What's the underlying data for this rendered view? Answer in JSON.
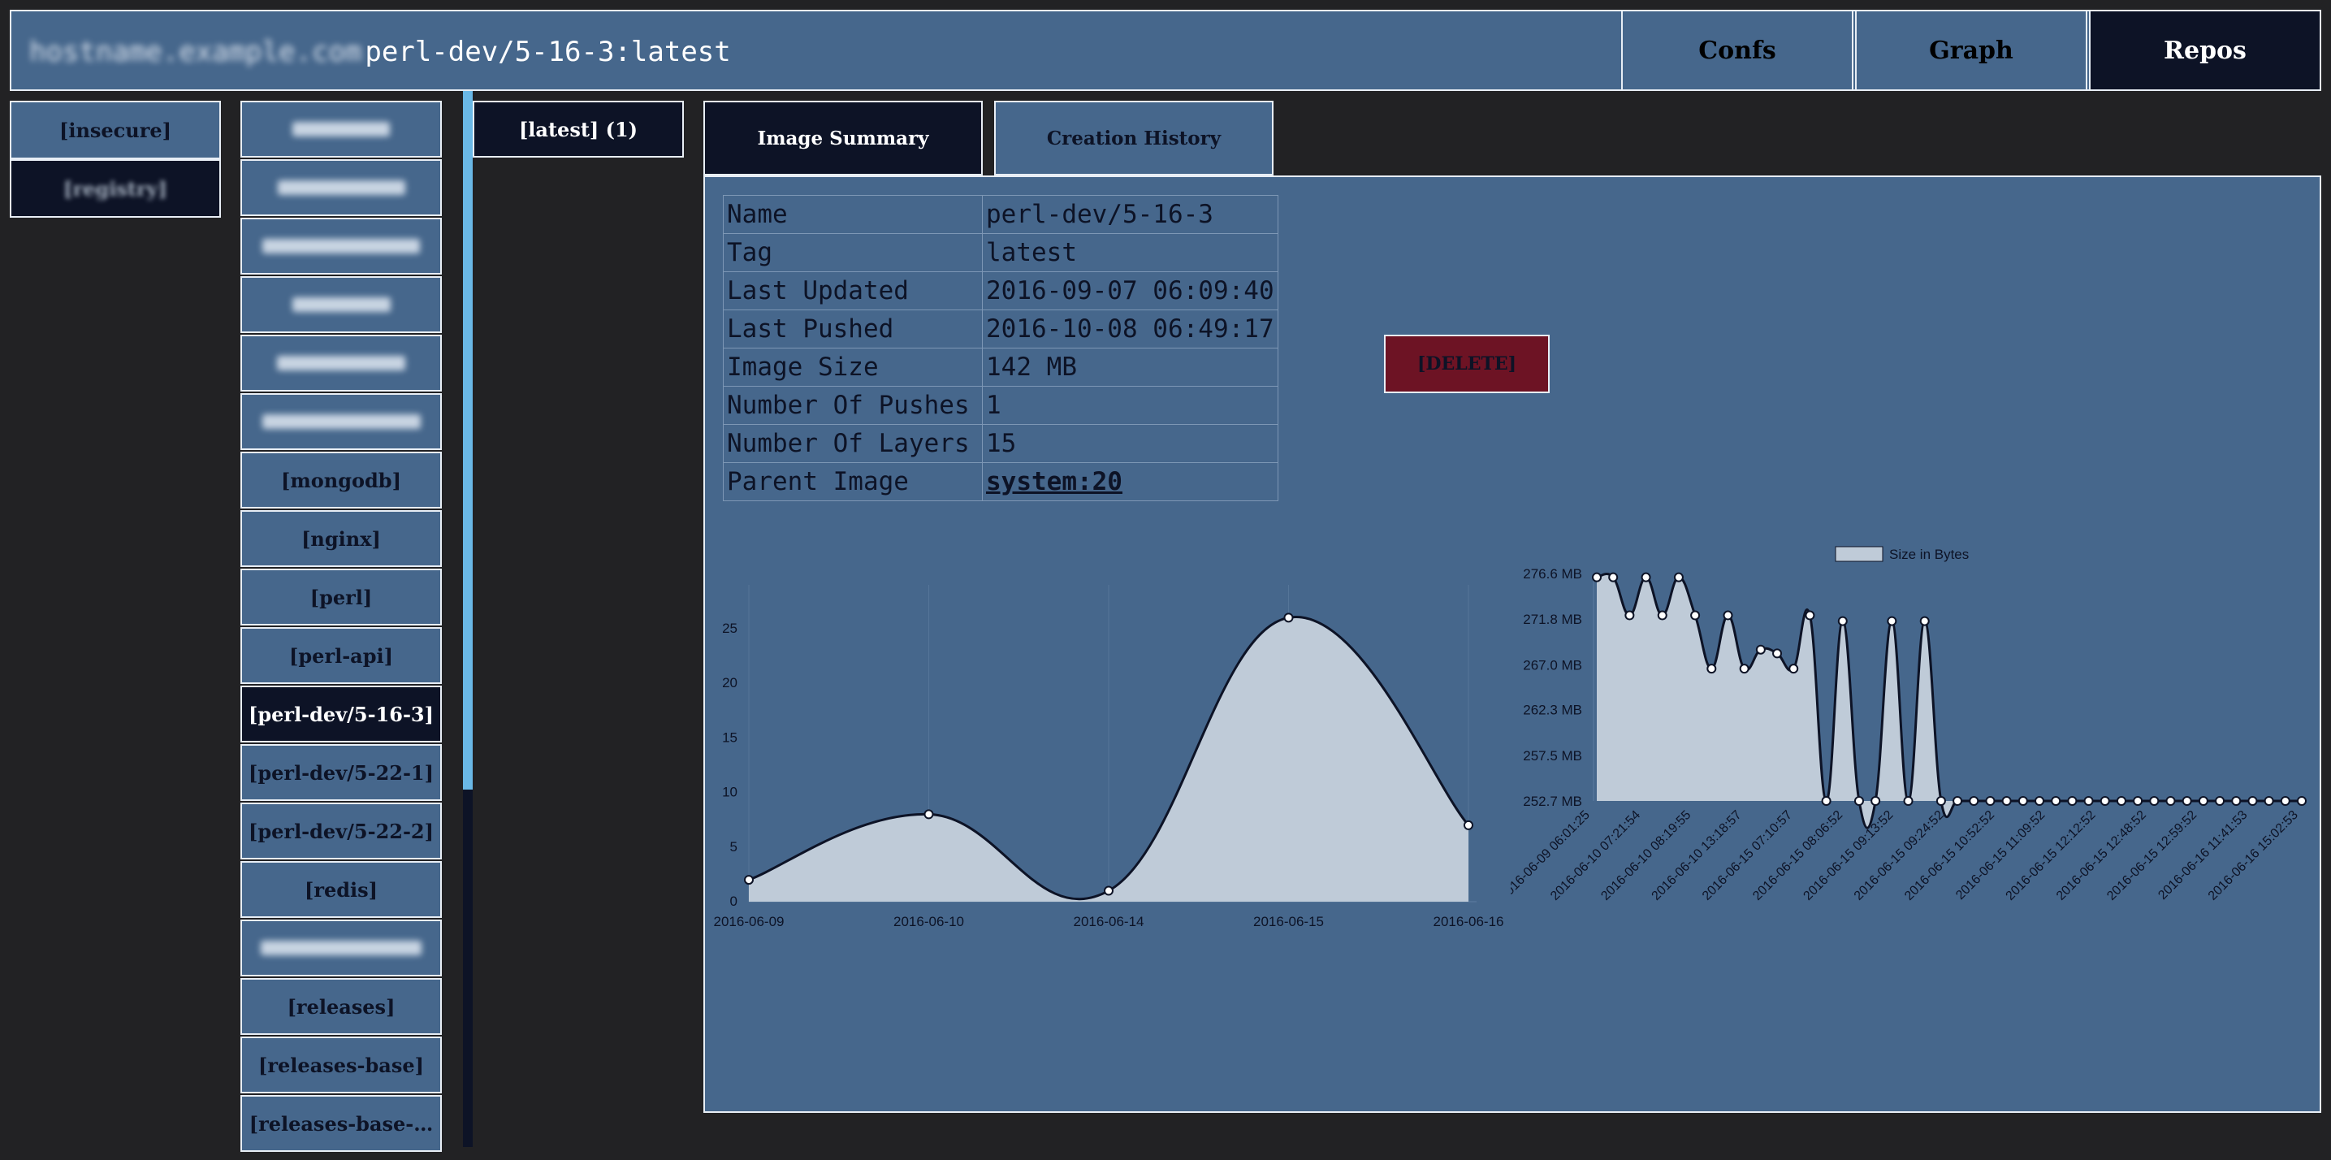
{
  "header": {
    "host_text": "hostname.example.com",
    "repo_path": "perl-dev/5-16-3:latest",
    "nav": [
      "Confs",
      "Graph",
      "Repos"
    ],
    "active_nav": "Repos"
  },
  "left_panel": {
    "items": [
      "[insecure]",
      "[registry]"
    ]
  },
  "repos": [
    {
      "label": "",
      "blurred": true
    },
    {
      "label": "",
      "blurred": true
    },
    {
      "label": "",
      "blurred": true
    },
    {
      "label": "",
      "blurred": true
    },
    {
      "label": "",
      "blurred": true
    },
    {
      "label": "",
      "blurred": true
    },
    {
      "label": "[mongodb]"
    },
    {
      "label": "[nginx]"
    },
    {
      "label": "[perl]"
    },
    {
      "label": "[perl-api]"
    },
    {
      "label": "[perl-dev/5-16-3]",
      "selected": true
    },
    {
      "label": "[perl-dev/5-22-1]"
    },
    {
      "label": "[perl-dev/5-22-2]"
    },
    {
      "label": "[redis]"
    },
    {
      "label": "",
      "blurred": true
    },
    {
      "label": "[releases]"
    },
    {
      "label": "[releases-base]"
    },
    {
      "label": "[releases-base-…"
    }
  ],
  "tags": {
    "latest_label": "[latest] (1)"
  },
  "tabs": {
    "summary": "Image Summary",
    "history": "Creation History"
  },
  "summary": {
    "rows": [
      {
        "key": "Name",
        "value": "perl-dev/5-16-3"
      },
      {
        "key": "Tag",
        "value": "latest"
      },
      {
        "key": "Last Updated",
        "value": "2016-09-07 06:09:40"
      },
      {
        "key": "Last Pushed",
        "value": "2016-10-08 06:49:17"
      },
      {
        "key": "Image Size",
        "value": "142 MB"
      },
      {
        "key": "Number Of Pushes",
        "value": "1"
      },
      {
        "key": "Number Of Layers",
        "value": "15"
      },
      {
        "key": "Parent Image",
        "value": "system:20",
        "link": true
      }
    ]
  },
  "delete_label": "[DELETE]",
  "colors": {
    "panel": "#46678c",
    "navy": "#0d1326",
    "delete": "#6d1324",
    "fill": "#bfcbd8"
  },
  "chart_data": [
    {
      "type": "area",
      "title": "",
      "x": [
        "2016-06-09",
        "2016-06-10",
        "2016-06-14",
        "2016-06-15",
        "2016-06-16"
      ],
      "values": [
        2,
        8,
        1,
        26,
        7
      ],
      "yticks": [
        0,
        5,
        10,
        15,
        20,
        25
      ],
      "ylim": [
        0,
        29
      ]
    },
    {
      "type": "area",
      "legend": "Size in Bytes",
      "legend_position": "top",
      "yticks": [
        "252.7 MB",
        "257.5 MB",
        "262.3 MB",
        "267.0 MB",
        "271.8 MB",
        "276.6 MB"
      ],
      "ylim_mb": [
        252.7,
        276.6
      ],
      "xticks": [
        "2016-06-09 06:01:25",
        "2016-06-10 07:21:54",
        "2016-06-10 08:19:55",
        "2016-06-10 13:18:57",
        "2016-06-15 07:10:57",
        "2016-06-15 08:06:52",
        "2016-06-15 09:13:52",
        "2016-06-15 09:24:52",
        "2016-06-15 10:52:52",
        "2016-06-15 11:09:52",
        "2016-06-15 12:12:52",
        "2016-06-15 12:48:52",
        "2016-06-15 12:59:52",
        "2016-06-16 11:41:53",
        "2016-06-16 15:02:53"
      ],
      "values_mb": [
        276.2,
        276.2,
        272.2,
        276.2,
        272.2,
        276.2,
        272.2,
        266.6,
        272.2,
        266.6,
        268.6,
        268.2,
        266.6,
        272.2,
        252.7,
        271.6,
        252.7,
        252.7,
        271.6,
        252.7,
        271.6,
        252.7,
        252.7,
        252.7,
        252.7,
        252.7,
        252.7,
        252.7,
        252.7,
        252.7,
        252.7,
        252.7,
        252.7,
        252.7,
        252.7,
        252.7,
        252.7,
        252.7,
        252.7,
        252.7,
        252.7,
        252.7,
        252.7,
        252.7
      ]
    }
  ]
}
